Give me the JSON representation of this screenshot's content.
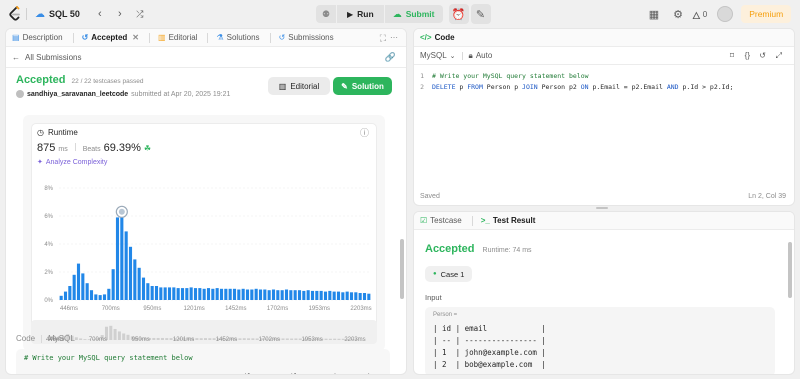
{
  "topbar": {
    "problem_list": "SQL 50",
    "run_label": "Run",
    "submit_label": "Submit",
    "notifications": "0",
    "premium_label": "Premium"
  },
  "left_tabs": [
    {
      "label": "Description",
      "icon": "description-icon"
    },
    {
      "label": "Accepted",
      "icon": "history-icon"
    },
    {
      "label": "Editorial",
      "icon": "book-icon"
    },
    {
      "label": "Solutions",
      "icon": "flask-icon"
    },
    {
      "label": "Submissions",
      "icon": "history-icon"
    }
  ],
  "submission": {
    "back_label": "All Submissions",
    "status": "Accepted",
    "testcases": "22 / 22 testcases passed",
    "user": "sandhiya_saravanan_leetcode",
    "submitted_at": "submitted at Apr 20, 2025 19:21",
    "editorial_btn": "Editorial",
    "solution_btn": "Solution"
  },
  "runtime": {
    "title": "Runtime",
    "value": "875",
    "unit": "ms",
    "beats_label": "Beats",
    "beats_value": "69.39%",
    "analyze_label": "Analyze Complexity"
  },
  "chart_data": {
    "type": "bar",
    "ylim": [
      0,
      8
    ],
    "yticks": [
      "8%",
      "6%",
      "4%",
      "2%",
      "0%"
    ],
    "xticks": [
      "446ms",
      "700ms",
      "950ms",
      "1201ms",
      "1452ms",
      "1702ms",
      "1953ms",
      "2203ms"
    ],
    "values": [
      0.3,
      0.6,
      1.0,
      1.8,
      2.6,
      1.9,
      1.2,
      0.7,
      0.4,
      0.35,
      0.4,
      0.8,
      2.2,
      5.9,
      6.3,
      4.9,
      3.8,
      2.9,
      2.3,
      1.6,
      1.2,
      1.0,
      1.0,
      0.9,
      0.9,
      0.9,
      0.9,
      0.85,
      0.85,
      0.85,
      0.9,
      0.85,
      0.85,
      0.8,
      0.85,
      0.8,
      0.85,
      0.8,
      0.8,
      0.8,
      0.8,
      0.75,
      0.8,
      0.75,
      0.75,
      0.8,
      0.75,
      0.75,
      0.7,
      0.75,
      0.7,
      0.7,
      0.75,
      0.7,
      0.7,
      0.7,
      0.65,
      0.7,
      0.65,
      0.65,
      0.65,
      0.6,
      0.65,
      0.6,
      0.6,
      0.55,
      0.6,
      0.55,
      0.55,
      0.5,
      0.5,
      0.45
    ],
    "highlight_index": 14,
    "grid": true
  },
  "code_section": {
    "title": "Code",
    "language": "MySQL",
    "lines": [
      "# Write your MySQL query statement below",
      "DELETE p FROM Person p JOIN Person p2 ON p.Email = p2.Email AND p.Id > p2.Id;"
    ]
  },
  "editor": {
    "tab_label": "Code",
    "language": "MySQL",
    "auto_label": "Auto",
    "saved_label": "Saved",
    "cursor_pos": "Ln 2, Col 39"
  },
  "result": {
    "testcase_tab": "Testcase",
    "result_tab": "Test Result",
    "status": "Accepted",
    "runtime": "Runtime: 74 ms",
    "case_label": "Case 1",
    "input_label": "Input",
    "table_name": "Person =",
    "table_lines": [
      "| id | email            |",
      "| -- | ---------------- |",
      "| 1  | john@example.com |",
      "| 2  | bob@example.com  |"
    ]
  }
}
